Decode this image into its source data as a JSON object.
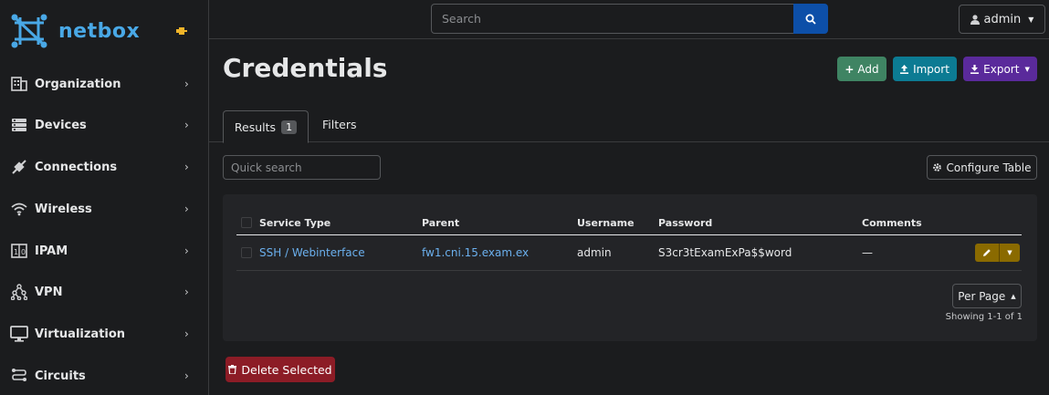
{
  "brand": {
    "name": "netbox"
  },
  "nav": [
    {
      "label": "Organization",
      "icon": "building-icon"
    },
    {
      "label": "Devices",
      "icon": "server-icon"
    },
    {
      "label": "Connections",
      "icon": "plug-icon"
    },
    {
      "label": "Wireless",
      "icon": "wifi-icon"
    },
    {
      "label": "IPAM",
      "icon": "counter-icon"
    },
    {
      "label": "VPN",
      "icon": "graph-icon"
    },
    {
      "label": "Virtualization",
      "icon": "monitor-icon"
    },
    {
      "label": "Circuits",
      "icon": "circuit-icon"
    }
  ],
  "topbar": {
    "search_placeholder": "Search",
    "user": "admin"
  },
  "page": {
    "title": "Credentials",
    "add": "Add",
    "import": "Import",
    "export": "Export"
  },
  "tabs": {
    "results": "Results",
    "results_count": "1",
    "filters": "Filters"
  },
  "toolbar": {
    "quick_search_placeholder": "Quick search",
    "configure": "Configure Table"
  },
  "table": {
    "headers": {
      "service_type": "Service Type",
      "parent": "Parent",
      "username": "Username",
      "password": "Password",
      "comments": "Comments"
    },
    "rows": [
      {
        "service_type": "SSH / Webinterface",
        "parent": "fw1.cni.15.exam.ex",
        "username": "admin",
        "password": "S3cr3tExamExPa$$word",
        "comments": "—"
      }
    ]
  },
  "pagination": {
    "per_page": "Per Page",
    "showing": "Showing 1-1 of 1"
  },
  "actions": {
    "delete_selected": "Delete Selected"
  },
  "colors": {
    "accent": "#49a8e6",
    "add": "#3f8463",
    "import": "#0c7b93",
    "export": "#5a2a9b",
    "delete": "#8c1c26",
    "edit": "#8a6a00"
  }
}
